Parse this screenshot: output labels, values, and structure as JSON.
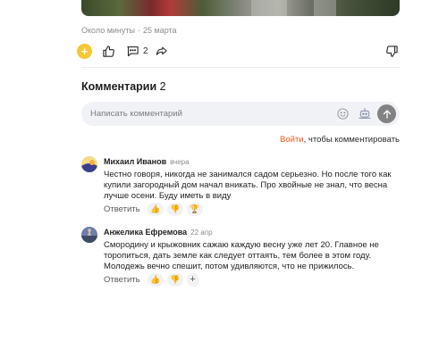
{
  "post": {
    "read_time": "Около минуты",
    "separator": "·",
    "date": "25 марта",
    "comments_count": "2"
  },
  "comments_section": {
    "title": "Комментарии",
    "count": "2",
    "input_placeholder": "Написать комментарий",
    "login_link": "Войти",
    "login_suffix": ", чтобы комментировать"
  },
  "comments": [
    {
      "author": "Михаил Иванов",
      "date": "вчера",
      "text": "Честно говоря, никогда не занимался садом серьезно. Но после того как купили загородный дом начал вникать. Про хвойные не знал, что весна лучше осени. Буду иметь в виду",
      "reply_label": "Ответить"
    },
    {
      "author": "Анжелика Ефремова",
      "date": "22 апр",
      "text": "Смородину и крыжовник сажаю каждую весну уже лет 20. Главное не торопиться, дать земле как следует оттаять, тем более в этом году. Молодежь вечно спешит, потом удивляются, что не прижилось.",
      "reply_label": "Ответить"
    }
  ],
  "icons": {
    "emoji_add": "plus-icon",
    "like": "thumbs-up-icon",
    "comments": "comment-bubble-icon",
    "share": "share-arrow-icon",
    "dislike": "thumbs-down-icon",
    "smile": "smile-icon",
    "bot": "robot-icon",
    "send": "arrow-up-icon"
  },
  "colors": {
    "accent_link": "#f55a1f",
    "emoji_yellow": "#f6c634",
    "input_bg": "#f1f2f5"
  }
}
